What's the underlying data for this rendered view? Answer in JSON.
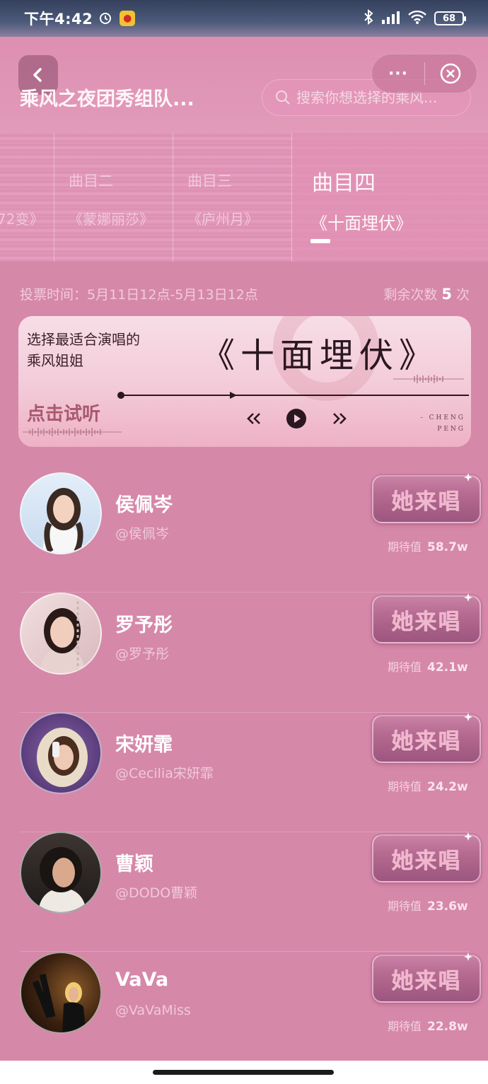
{
  "status_bar": {
    "time": "下午4:42",
    "battery": "68"
  },
  "header": {
    "title": "乘风之夜团秀组队...",
    "more_label": "···",
    "search_placeholder": "搜索你想选择的乘风..."
  },
  "tabs": [
    {
      "num": "",
      "song": "72变》",
      "active": false
    },
    {
      "num": "曲目二",
      "song": "《蒙娜丽莎》",
      "active": false
    },
    {
      "num": "曲目三",
      "song": "《庐州月》",
      "active": false
    },
    {
      "num": "曲目四",
      "song": "《十面埋伏》",
      "active": true
    }
  ],
  "vote": {
    "time_label": "投票时间：5月11日12点-5月13日12点",
    "remaining_prefix": "剩余次数",
    "remaining_count": "5",
    "remaining_suffix": "次"
  },
  "player": {
    "subtitle_line1": "选择最适合演唱的",
    "subtitle_line2": "乘风姐姐",
    "song_title": "《十面埋伏》",
    "listen_label": "点击试听",
    "brand_line1": "- CHENG",
    "brand_line2": "PENG"
  },
  "sing_label": "她来唱",
  "expect_label": "期待值",
  "singers": [
    {
      "name": "侯佩岑",
      "handle": "@侯佩岑",
      "expect": "58.7w"
    },
    {
      "name": "罗予彤",
      "handle": "@罗予彤",
      "expect": "42.1w"
    },
    {
      "name": "宋妍霏",
      "handle": "@Cecilia宋妍霏",
      "expect": "24.2w"
    },
    {
      "name": "曹颖",
      "handle": "@DODO曹颖",
      "expect": "23.6w"
    },
    {
      "name": "VaVa",
      "handle": "@VaVaMiss",
      "expect": "22.8w"
    }
  ],
  "colors": {
    "background": "#d688a9",
    "card": "#f3ccd9",
    "button": "#ad6389"
  }
}
